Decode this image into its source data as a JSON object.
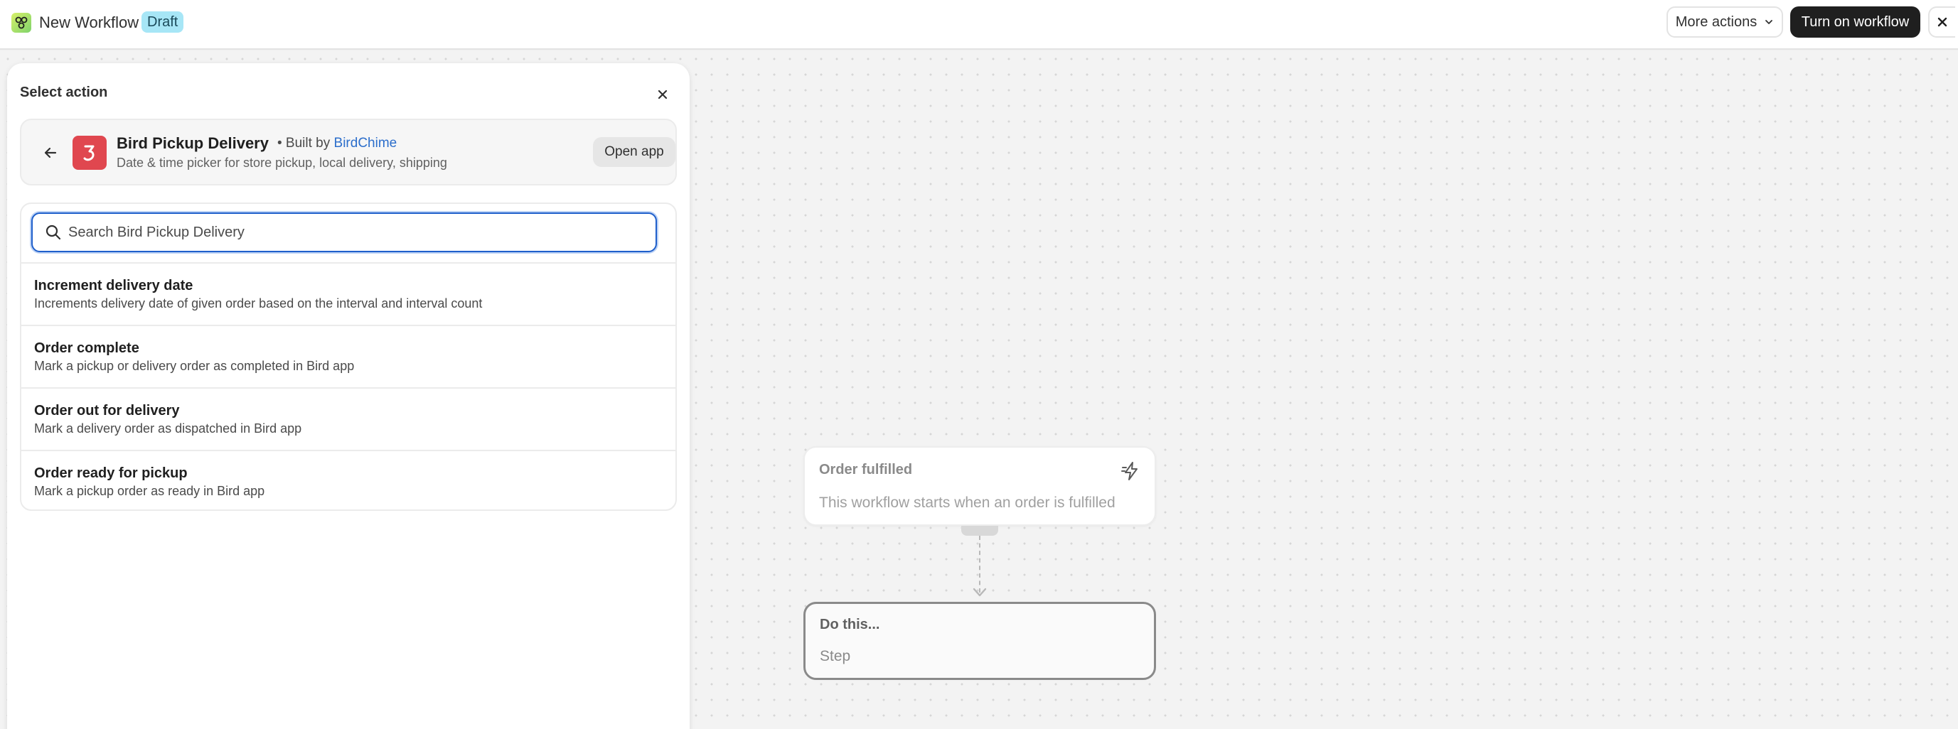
{
  "header": {
    "workflow_title": "New Workflow",
    "status_badge": "Draft",
    "more_actions_label": "More actions",
    "turn_on_label": "Turn on workflow"
  },
  "panel": {
    "title": "Select action",
    "app": {
      "name": "Bird Pickup Delivery",
      "built_by_prefix": "• Built by",
      "developer": "BirdChime",
      "description": "Date & time picker for store pickup, local delivery, shipping",
      "open_app_label": "Open app",
      "brand_color": "#e0474f"
    },
    "search": {
      "placeholder": "Search Bird Pickup Delivery",
      "value": ""
    },
    "actions": [
      {
        "name": "Increment delivery date",
        "description": "Increments delivery date of given order based on the interval and interval count"
      },
      {
        "name": "Order complete",
        "description": "Mark a pickup or delivery order as completed in Bird app"
      },
      {
        "name": "Order out for delivery",
        "description": "Mark a delivery order as dispatched in Bird app"
      },
      {
        "name": "Order ready for pickup",
        "description": "Mark a pickup order as ready in Bird app"
      }
    ]
  },
  "flow": {
    "trigger": {
      "title": "Order fulfilled",
      "description": "This workflow starts when an order is fulfilled",
      "icon": "bolt-icon"
    },
    "step": {
      "title": "Do this...",
      "subtitle": "Step"
    }
  },
  "colors": {
    "accent_blue": "#1f5fcb",
    "draft_badge": "#a7e6f6",
    "primary_button": "#1f1f1f"
  }
}
